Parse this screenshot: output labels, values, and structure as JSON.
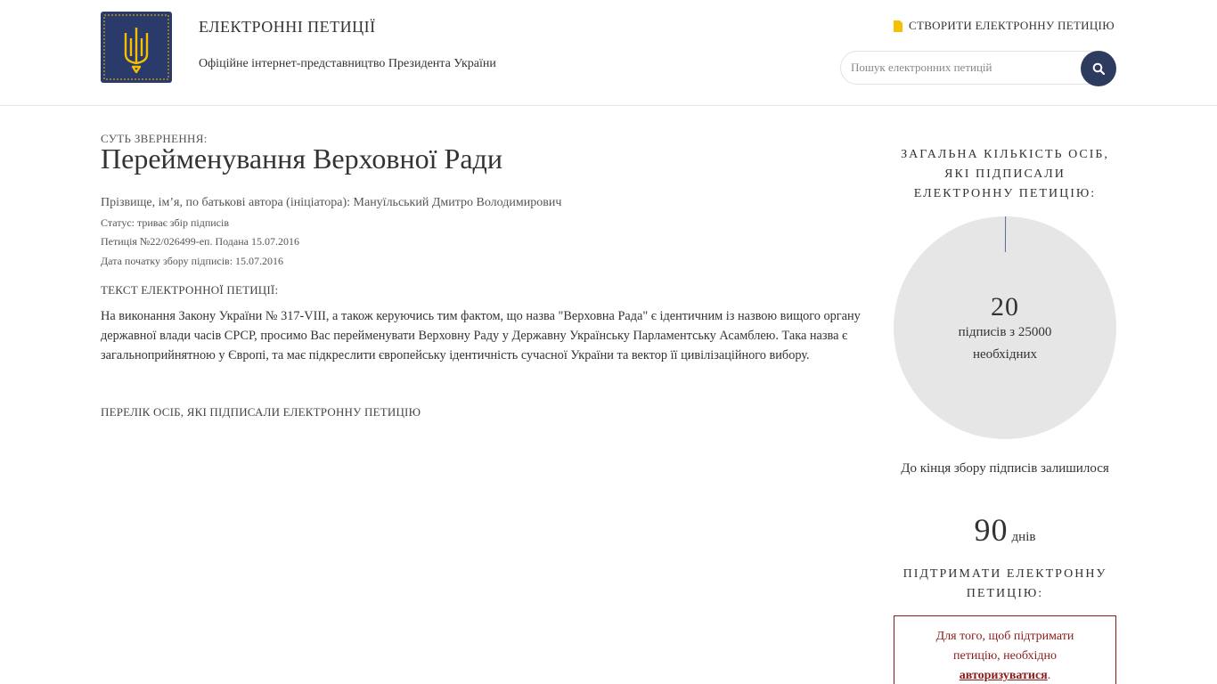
{
  "header": {
    "site_title": "ЕЛЕКТРОННІ ПЕТИЦІЇ",
    "site_subtitle": "Офіційне інтернет-представництво Президента України",
    "create_link": "СТВОРИТИ ЕЛЕКТРОННУ ПЕТИЦІЮ",
    "search_placeholder": "Пошук електронних петицій",
    "logo_icon": "trident-emblem-icon",
    "create_icon": "document-icon",
    "search_icon": "search-icon"
  },
  "petition": {
    "essence_label": "СУТЬ ЗВЕРНЕННЯ:",
    "title": "Перейменування Верховної Ради",
    "author": "Прізвище, ім’я, по батькові автора (ініціатора): Мануїльський Дмитро Володимирович",
    "status": "Статус: триває збір підписів",
    "number": "Петиція №22/026499-еп. Подана 15.07.2016",
    "start_date": "Дата початку збору підписів: 15.07.2016",
    "text_label": "ТЕКСТ ЕЛЕКТРОННОЇ ПЕТИЦІЇ:",
    "text": "На виконання Закону України № 317-VIII, а також керуючись тим фактом, що назва \"Верховна Рада\" є ідентичним із назвою вищого органу державної влади часів СРСР, просимо Вас перейменувати Верховну Раду у Державну Українську Парламентську Асамблею. Така назва є загальноприйнятною у Європі, та має підкреслити європейську ідентичність сучасної України та вектор її цивілізаційного вибору.",
    "signers_link": "ПЕРЕЛІК ОСІБ, ЯКІ ПІДПИСАЛИ ЕЛЕКТРОННУ ПЕТИЦІЮ"
  },
  "sidebar": {
    "count_heading": "ЗАГАЛЬНА КІЛЬКІСТЬ ОСІБ, ЯКІ ПІДПИСАЛИ ЕЛЕКТРОННУ ПЕТИЦІЮ:",
    "signatures": "20",
    "signatures_label": "підписів з 25000 необхідних",
    "progress_fraction": 0.0008,
    "deadline_text": "До кінця збору підписів залишилося",
    "days_number": "90",
    "days_label": "днів",
    "support_heading": "ПІДТРИМАТИ ЕЛЕКТРОННУ ПЕТИЦІЮ:",
    "auth_text_before": "Для того, щоб підтримати петицію, необхідно",
    "auth_link": "авторизуватися",
    "auth_text_after": "."
  },
  "colors": {
    "brand_navy": "#2d3b5f",
    "accent_gold": "#f5c000",
    "circle_bg": "#e6e6e6",
    "auth_red": "#8b1a1a",
    "progress_stroke": "#5a6a9a"
  }
}
